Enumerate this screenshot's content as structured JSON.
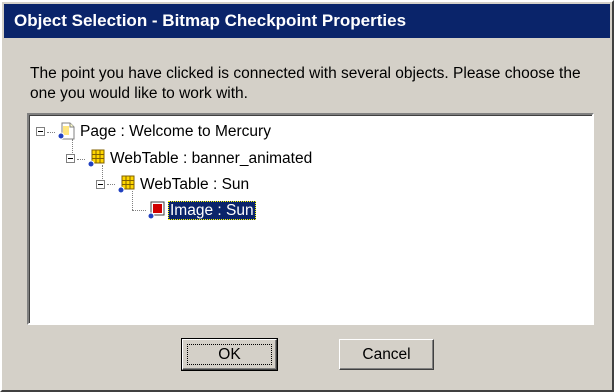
{
  "dialog": {
    "title": "Object Selection - Bitmap Checkpoint Properties",
    "message": "The point you have clicked is connected with several objects. Please choose the one you would like to work with."
  },
  "tree": {
    "nodes": [
      {
        "label": "Page : Welcome to Mercury",
        "icon": "page-icon",
        "expanded": true,
        "selected": false
      },
      {
        "label": "WebTable : banner_animated",
        "icon": "webtable-icon",
        "expanded": true,
        "selected": false
      },
      {
        "label": "WebTable : Sun",
        "icon": "webtable-icon",
        "expanded": true,
        "selected": false
      },
      {
        "label": "Image : Sun",
        "icon": "image-icon",
        "expanded": false,
        "selected": true
      }
    ]
  },
  "buttons": {
    "ok": "OK",
    "cancel": "Cancel"
  },
  "colors": {
    "titlebar": "#0a246a",
    "dialog_bg": "#d4d0c8",
    "selection": "#0a246a"
  }
}
